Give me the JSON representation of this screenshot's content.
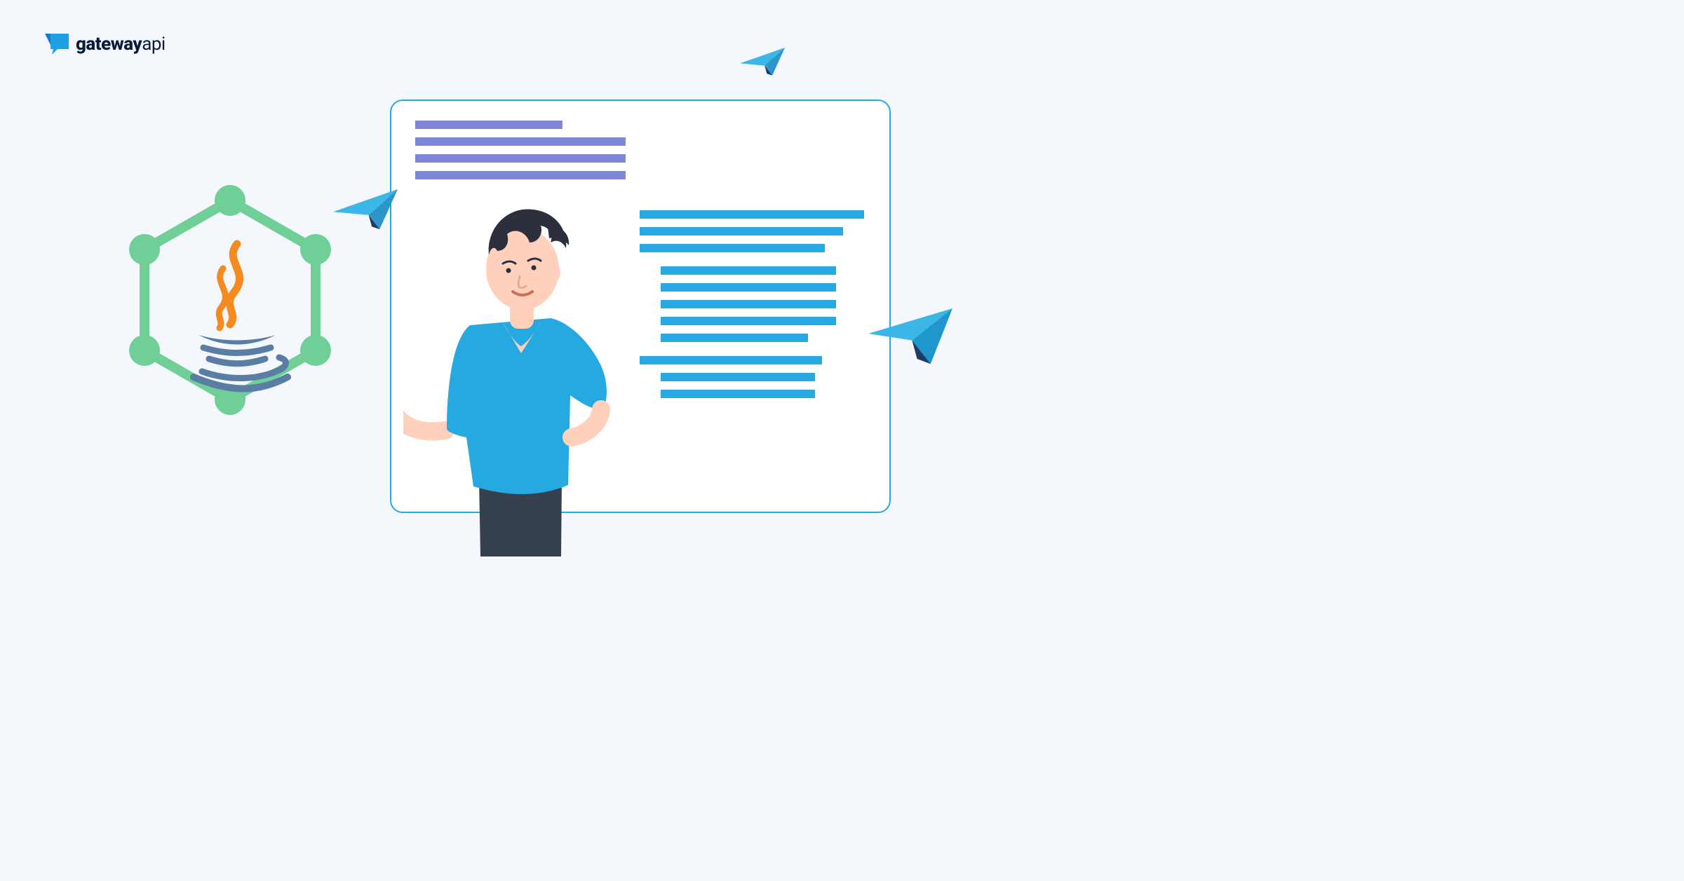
{
  "brand": {
    "name_bold": "gateway",
    "name_thin": "api"
  },
  "colors": {
    "background": "#f4f7fc",
    "panel_border": "#25a9e0",
    "panel_bg": "#ffffff",
    "bar_purple": "#7e86d7",
    "bar_cyan": "#25a9e0",
    "hex_green": "#70cf97",
    "java_cup": "#5a7ea3",
    "java_steam": "#f58a1f",
    "plane_light": "#3ab7e7",
    "plane_dark": "#1d3b66",
    "shirt": "#25a9e0",
    "skin": "#ffd1bd",
    "hair": "#2c2f3c",
    "pants": "#36404f",
    "logo_dark": "#0c1b3a",
    "logo_blue_a": "#1fa0e4",
    "logo_blue_b": "#147bd1"
  },
  "icons": {
    "hexagon": "java-hexagon",
    "planes": [
      "paper-plane-top",
      "paper-plane-mid",
      "paper-plane-right"
    ],
    "logo": "gatewayapi-logo"
  }
}
